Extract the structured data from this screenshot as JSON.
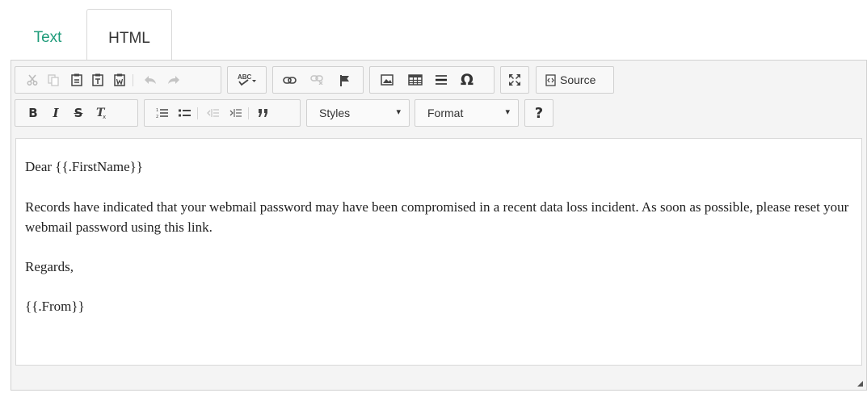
{
  "tabs": [
    {
      "label": "Text",
      "active": false
    },
    {
      "label": "HTML",
      "active": true
    }
  ],
  "toolbar": {
    "source_label": "Source",
    "styles_label": "Styles",
    "format_label": "Format",
    "bold": "B",
    "italic": "I",
    "strike": "S",
    "remove_format": "Tx",
    "help": "?",
    "omega": "Ω",
    "spell": "ABC"
  },
  "content": {
    "greeting": "Dear {{.FirstName}}",
    "body": "Records have indicated that your webmail password may have been compromised in a recent data loss incident. As soon as possible, please reset your webmail password using this link.",
    "closing": "Regards,",
    "signature": "{{.From}}"
  },
  "colors": {
    "accent": "#1f9b7a"
  }
}
